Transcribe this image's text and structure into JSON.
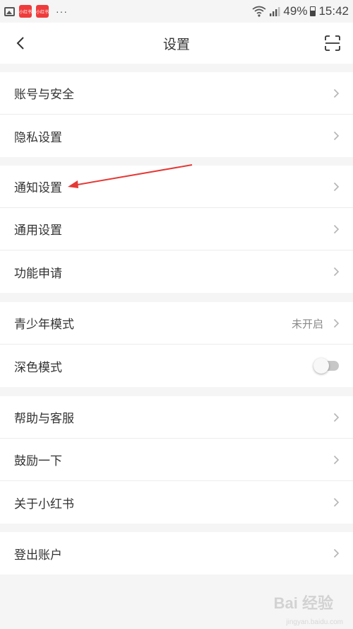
{
  "status_bar": {
    "app_icon_1_text": "小红书",
    "app_icon_2_text": "小红书",
    "dots": "···",
    "battery_percent": "49%",
    "time": "15:42"
  },
  "nav": {
    "title": "设置"
  },
  "groups": [
    {
      "items": [
        {
          "label": "账号与安全"
        },
        {
          "label": "隐私设置"
        }
      ]
    },
    {
      "items": [
        {
          "label": "通知设置"
        },
        {
          "label": "通用设置"
        },
        {
          "label": "功能申请"
        }
      ]
    },
    {
      "items": [
        {
          "label": "青少年模式",
          "value": "未开启"
        },
        {
          "label": "深色模式",
          "toggle_on": false
        }
      ]
    },
    {
      "items": [
        {
          "label": "帮助与客服"
        },
        {
          "label": "鼓励一下"
        },
        {
          "label": "关于小红书"
        }
      ]
    },
    {
      "items": [
        {
          "label": "登出账户"
        }
      ]
    }
  ],
  "watermark": {
    "text": "Bai 经验",
    "sub": "jingyan.baidu.com"
  },
  "colors": {
    "background": "#f5f5f5",
    "row_background": "#ffffff",
    "annotation_arrow": "#e53935",
    "app_icon": "#ef3b3b"
  },
  "icons": {
    "back": "chevron-left-icon",
    "scan": "scan-icon",
    "row_chevron": "chevron-right-icon",
    "wifi": "wifi-icon",
    "signal": "signal-icon",
    "battery": "battery-icon",
    "gallery": "gallery-icon"
  }
}
